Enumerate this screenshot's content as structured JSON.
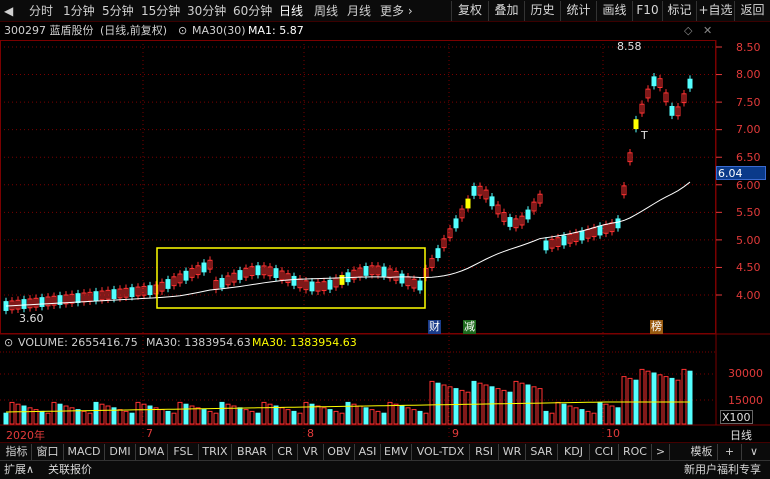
{
  "toolbar": {
    "periods": [
      "分时",
      "1分钟",
      "5分钟",
      "15分钟",
      "30分钟",
      "60分钟",
      "日线",
      "周线",
      "月线",
      "更多 ›"
    ],
    "active_period": "日线",
    "buttons": [
      "复权",
      "叠加",
      "历史",
      "统计",
      "画线",
      "F10",
      "标记",
      "+自选",
      "返回"
    ]
  },
  "info": {
    "stock": "300297 蓝盾股份",
    "mode": "(日线,前复权)",
    "ma_label": "MA30(30)",
    "ma1": "MA1: 5.87"
  },
  "price_axis": [
    "8.50",
    "8.00",
    "7.50",
    "7.00",
    "6.50",
    "6.00",
    "5.50",
    "5.00",
    "4.50",
    "4.00"
  ],
  "current_price_tag": "6.04",
  "annotations": {
    "high": "8.58",
    "low": "3.60",
    "cai": "财",
    "jian": "减",
    "bang": "榜",
    "t_mark": "T"
  },
  "volume_info": {
    "volume": "VOLUME: 2655416.75",
    "ma30": "MA30: 1383954.63",
    "ma30_yellow": "MA30: 1383954.63"
  },
  "volume_axis": [
    "30000",
    "15000"
  ],
  "volume_unit": "X100",
  "dates": {
    "year": "2020年",
    "m7": "7",
    "m8": "8",
    "m9": "9",
    "m10": "10",
    "period_label": "日线"
  },
  "indicator_tabs": [
    "指标",
    "窗口",
    "MACD",
    "DMI",
    "DMA",
    "FSL",
    "TRIX",
    "BRAR",
    "CR",
    "VR",
    "OBV",
    "ASI",
    "EMV",
    "VOL-TDX",
    "RSI",
    "WR",
    "SAR",
    "KDJ",
    "CCI",
    "ROC",
    ">"
  ],
  "bottom": {
    "expand": "扩展∧",
    "related": "关联报价",
    "template": "模板",
    "plus": "+",
    "arrow": "∨",
    "promo": "新用户福利专享"
  },
  "colors": {
    "up": "#ff3232",
    "down": "#54ffff",
    "highlight": "#ffff00",
    "ma": "#ffffff",
    "grid": "#7a0000"
  }
}
